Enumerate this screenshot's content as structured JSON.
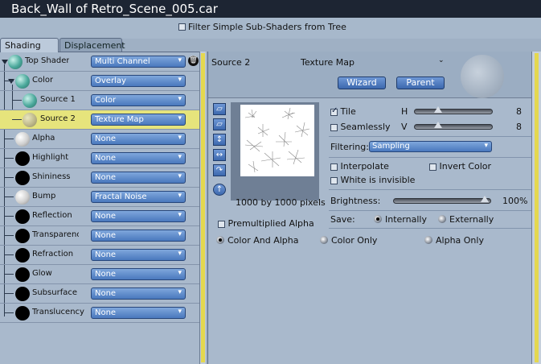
{
  "window": {
    "title": "Back_Wall of Retro_Scene_005.car"
  },
  "filter": {
    "label": "Filter Simple Sub-Shaders from Tree",
    "checked": false
  },
  "tabs": [
    {
      "label": "Shading",
      "active": true
    },
    {
      "label": "Displacement",
      "active": false
    }
  ],
  "tree": {
    "rows": [
      {
        "label": "Top Shader",
        "value": "Multi Channel",
        "ball": "teal"
      },
      {
        "label": "Color",
        "value": "Overlay",
        "ball": "teal"
      },
      {
        "label": "Source 1",
        "value": "Color",
        "ball": "teal"
      },
      {
        "label": "Source 2",
        "value": "Texture Map",
        "ball": "texture",
        "selected": true
      },
      {
        "label": "Alpha",
        "value": "None",
        "ball": "white"
      },
      {
        "label": "Highlight",
        "value": "None",
        "ball": "black"
      },
      {
        "label": "Shininess",
        "value": "None",
        "ball": "black"
      },
      {
        "label": "Bump",
        "value": "Fractal Noise",
        "ball": "white"
      },
      {
        "label": "Reflection",
        "value": "None",
        "ball": "black"
      },
      {
        "label": "Transparency",
        "value": "None",
        "ball": "black"
      },
      {
        "label": "Refraction",
        "value": "None",
        "ball": "black"
      },
      {
        "label": "Glow",
        "value": "None",
        "ball": "black"
      },
      {
        "label": "Subsurface Sc",
        "value": "None",
        "ball": "black"
      },
      {
        "label": "Translucency",
        "value": "None",
        "ball": "black"
      }
    ]
  },
  "source": {
    "title": "Source 2",
    "type": "Texture Map",
    "wizard_label": "Wizard",
    "parent_label": "Parent",
    "pixels_label": "1000 by 1000 pixels",
    "premultiplied_label": "Premultiplied Alpha",
    "premultiplied_checked": false,
    "color_and_alpha_label": "Color And Alpha",
    "color_only_label": "Color Only",
    "alpha_only_label": "Alpha Only",
    "channel_mode": "Color And Alpha",
    "tile_label": "Tile",
    "tile_checked": true,
    "h_label": "H",
    "h_value": "8",
    "seamlessly_label": "Seamlessly",
    "seamlessly_checked": false,
    "v_label": "V",
    "v_value": "8",
    "filtering_label": "Filtering:",
    "filtering_value": "Sampling",
    "interpolate_label": "Interpolate",
    "invert_color_label": "Invert Color",
    "white_invisible_label": "White is invisible",
    "brightness_label": "Brightness:",
    "brightness_value": "100%",
    "brightness_level": 1.0,
    "save_label": "Save:",
    "internally_label": "Internally",
    "externally_label": "Externally",
    "save_mode": "Internally"
  },
  "colors": {
    "title_bg": "#1d2533",
    "panel_bg": "#a9b9cc",
    "dropdown": "#4a78bd",
    "selection": "#e6e47c"
  }
}
